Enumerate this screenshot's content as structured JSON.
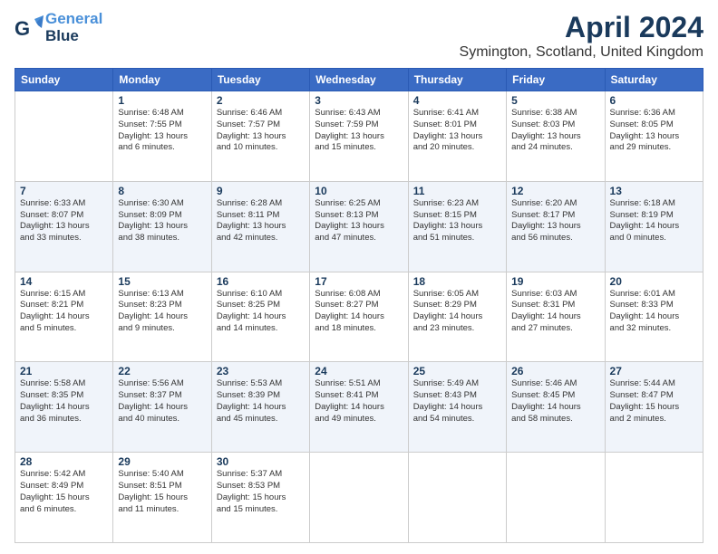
{
  "header": {
    "logo_line1": "General",
    "logo_line2": "Blue",
    "title": "April 2024",
    "subtitle": "Symington, Scotland, United Kingdom"
  },
  "days_of_week": [
    "Sunday",
    "Monday",
    "Tuesday",
    "Wednesday",
    "Thursday",
    "Friday",
    "Saturday"
  ],
  "weeks": [
    [
      {
        "num": "",
        "detail": ""
      },
      {
        "num": "1",
        "detail": "Sunrise: 6:48 AM\nSunset: 7:55 PM\nDaylight: 13 hours\nand 6 minutes."
      },
      {
        "num": "2",
        "detail": "Sunrise: 6:46 AM\nSunset: 7:57 PM\nDaylight: 13 hours\nand 10 minutes."
      },
      {
        "num": "3",
        "detail": "Sunrise: 6:43 AM\nSunset: 7:59 PM\nDaylight: 13 hours\nand 15 minutes."
      },
      {
        "num": "4",
        "detail": "Sunrise: 6:41 AM\nSunset: 8:01 PM\nDaylight: 13 hours\nand 20 minutes."
      },
      {
        "num": "5",
        "detail": "Sunrise: 6:38 AM\nSunset: 8:03 PM\nDaylight: 13 hours\nand 24 minutes."
      },
      {
        "num": "6",
        "detail": "Sunrise: 6:36 AM\nSunset: 8:05 PM\nDaylight: 13 hours\nand 29 minutes."
      }
    ],
    [
      {
        "num": "7",
        "detail": "Sunrise: 6:33 AM\nSunset: 8:07 PM\nDaylight: 13 hours\nand 33 minutes."
      },
      {
        "num": "8",
        "detail": "Sunrise: 6:30 AM\nSunset: 8:09 PM\nDaylight: 13 hours\nand 38 minutes."
      },
      {
        "num": "9",
        "detail": "Sunrise: 6:28 AM\nSunset: 8:11 PM\nDaylight: 13 hours\nand 42 minutes."
      },
      {
        "num": "10",
        "detail": "Sunrise: 6:25 AM\nSunset: 8:13 PM\nDaylight: 13 hours\nand 47 minutes."
      },
      {
        "num": "11",
        "detail": "Sunrise: 6:23 AM\nSunset: 8:15 PM\nDaylight: 13 hours\nand 51 minutes."
      },
      {
        "num": "12",
        "detail": "Sunrise: 6:20 AM\nSunset: 8:17 PM\nDaylight: 13 hours\nand 56 minutes."
      },
      {
        "num": "13",
        "detail": "Sunrise: 6:18 AM\nSunset: 8:19 PM\nDaylight: 14 hours\nand 0 minutes."
      }
    ],
    [
      {
        "num": "14",
        "detail": "Sunrise: 6:15 AM\nSunset: 8:21 PM\nDaylight: 14 hours\nand 5 minutes."
      },
      {
        "num": "15",
        "detail": "Sunrise: 6:13 AM\nSunset: 8:23 PM\nDaylight: 14 hours\nand 9 minutes."
      },
      {
        "num": "16",
        "detail": "Sunrise: 6:10 AM\nSunset: 8:25 PM\nDaylight: 14 hours\nand 14 minutes."
      },
      {
        "num": "17",
        "detail": "Sunrise: 6:08 AM\nSunset: 8:27 PM\nDaylight: 14 hours\nand 18 minutes."
      },
      {
        "num": "18",
        "detail": "Sunrise: 6:05 AM\nSunset: 8:29 PM\nDaylight: 14 hours\nand 23 minutes."
      },
      {
        "num": "19",
        "detail": "Sunrise: 6:03 AM\nSunset: 8:31 PM\nDaylight: 14 hours\nand 27 minutes."
      },
      {
        "num": "20",
        "detail": "Sunrise: 6:01 AM\nSunset: 8:33 PM\nDaylight: 14 hours\nand 32 minutes."
      }
    ],
    [
      {
        "num": "21",
        "detail": "Sunrise: 5:58 AM\nSunset: 8:35 PM\nDaylight: 14 hours\nand 36 minutes."
      },
      {
        "num": "22",
        "detail": "Sunrise: 5:56 AM\nSunset: 8:37 PM\nDaylight: 14 hours\nand 40 minutes."
      },
      {
        "num": "23",
        "detail": "Sunrise: 5:53 AM\nSunset: 8:39 PM\nDaylight: 14 hours\nand 45 minutes."
      },
      {
        "num": "24",
        "detail": "Sunrise: 5:51 AM\nSunset: 8:41 PM\nDaylight: 14 hours\nand 49 minutes."
      },
      {
        "num": "25",
        "detail": "Sunrise: 5:49 AM\nSunset: 8:43 PM\nDaylight: 14 hours\nand 54 minutes."
      },
      {
        "num": "26",
        "detail": "Sunrise: 5:46 AM\nSunset: 8:45 PM\nDaylight: 14 hours\nand 58 minutes."
      },
      {
        "num": "27",
        "detail": "Sunrise: 5:44 AM\nSunset: 8:47 PM\nDaylight: 15 hours\nand 2 minutes."
      }
    ],
    [
      {
        "num": "28",
        "detail": "Sunrise: 5:42 AM\nSunset: 8:49 PM\nDaylight: 15 hours\nand 6 minutes."
      },
      {
        "num": "29",
        "detail": "Sunrise: 5:40 AM\nSunset: 8:51 PM\nDaylight: 15 hours\nand 11 minutes."
      },
      {
        "num": "30",
        "detail": "Sunrise: 5:37 AM\nSunset: 8:53 PM\nDaylight: 15 hours\nand 15 minutes."
      },
      {
        "num": "",
        "detail": ""
      },
      {
        "num": "",
        "detail": ""
      },
      {
        "num": "",
        "detail": ""
      },
      {
        "num": "",
        "detail": ""
      }
    ]
  ]
}
